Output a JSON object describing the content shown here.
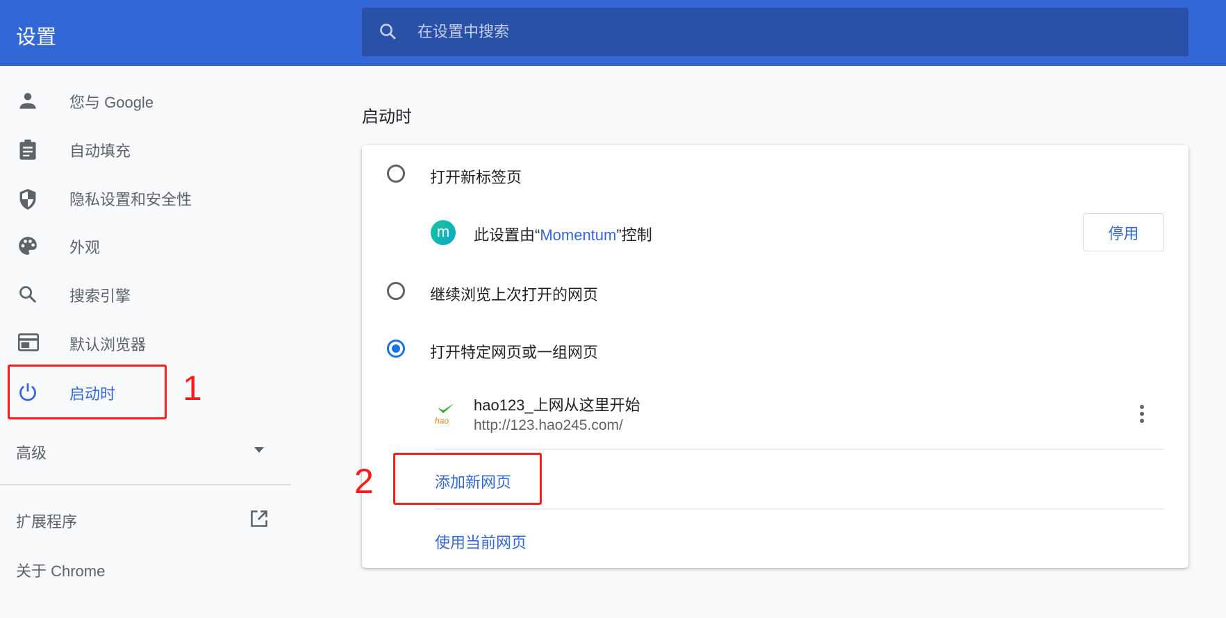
{
  "header": {
    "title": "设置",
    "search_placeholder": "在设置中搜索"
  },
  "sidebar": {
    "items": [
      {
        "label": "您与 Google",
        "icon": "person-icon"
      },
      {
        "label": "自动填充",
        "icon": "clipboard-icon"
      },
      {
        "label": "隐私设置和安全性",
        "icon": "shield-icon"
      },
      {
        "label": "外观",
        "icon": "palette-icon"
      },
      {
        "label": "搜索引擎",
        "icon": "search-icon"
      },
      {
        "label": "默认浏览器",
        "icon": "browser-icon"
      },
      {
        "label": "启动时",
        "icon": "power-icon",
        "active": true
      }
    ],
    "advanced": "高级",
    "extensions": "扩展程序",
    "about": "关于 Chrome"
  },
  "annotations": {
    "one": "1",
    "two": "2",
    "color": "#ff1a1a"
  },
  "main": {
    "heading": "启动时",
    "options": [
      {
        "label": "打开新标签页",
        "checked": false
      },
      {
        "label": "继续浏览上次打开的网页",
        "checked": false
      },
      {
        "label": "打开特定网页或一组网页",
        "checked": true
      }
    ],
    "controlled": {
      "prefix": "此设置由“",
      "extension": "Momentum",
      "suffix": "”控制",
      "button": "停用"
    },
    "page": {
      "title": "hao123_上网从这里开始",
      "url": "http://123.hao245.com/",
      "icon_text": "hao"
    },
    "add_page": "添加新网页",
    "use_current": "使用当前网页"
  },
  "colors": {
    "header": "#3367d6",
    "accent": "#1a73e8"
  }
}
